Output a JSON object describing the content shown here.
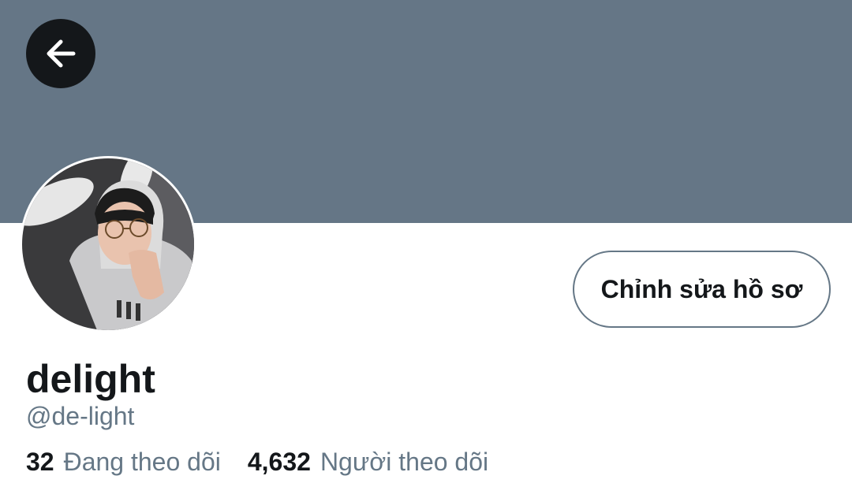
{
  "profile": {
    "banner_color": "#657686",
    "display_name": "delight",
    "handle": "@de-light",
    "avatar": "profile-photo"
  },
  "header": {
    "back_icon": "arrow-left-icon"
  },
  "actions": {
    "edit_profile_label": "Chỉnh sửa hồ sơ"
  },
  "stats": {
    "following_count": "32",
    "following_label": "Đang theo dõi",
    "followers_count": "4,632",
    "followers_label": "Người theo dõi"
  }
}
